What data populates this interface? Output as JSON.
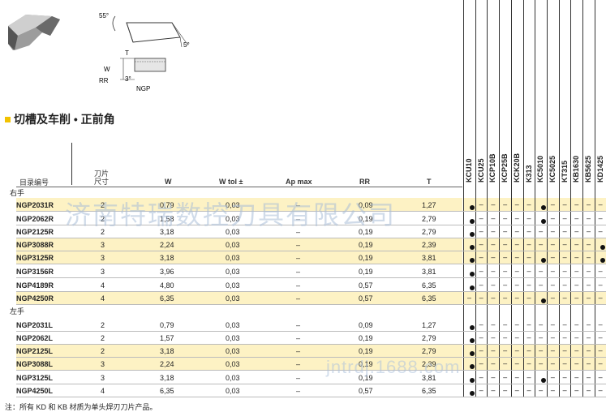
{
  "section_title": "切槽及车削 • 正前角",
  "drawing_labels": {
    "angle_top": "55°",
    "angle_side": "5°",
    "t": "T",
    "w": "W",
    "rr": "RR",
    "angle_small": "3°",
    "name": "NGP"
  },
  "headers": {
    "code": "目录编号",
    "blade_line1": "刀片",
    "blade_line2": "尺寸",
    "w": "W",
    "wtol": "W tol ±",
    "ap": "Ap max",
    "rr": "RR",
    "t": "T"
  },
  "grades": [
    "KCU10",
    "KCU25",
    "KCP10B",
    "KCP25B",
    "KCK20B",
    "K313",
    "KC5010",
    "KC5025",
    "KT315",
    "KB1630",
    "KB5625",
    "KD1425"
  ],
  "group_right": "右手",
  "group_left": "左手",
  "rows_right": [
    {
      "code": "NGP2031R",
      "blade": "2",
      "w": "0,79",
      "wtol": "0,03",
      "ap": "–",
      "rr": "0,09",
      "t": "1,27",
      "band": true,
      "marks": [
        "●",
        "–",
        "–",
        "–",
        "–",
        "–",
        "●",
        "–",
        "–",
        "–",
        "–",
        "–"
      ]
    },
    {
      "code": "NGP2062R",
      "blade": "2",
      "w": "1,58",
      "wtol": "0,03",
      "ap": "–",
      "rr": "0,19",
      "t": "2,79",
      "band": false,
      "marks": [
        "●",
        "–",
        "–",
        "–",
        "–",
        "–",
        "●",
        "–",
        "–",
        "–",
        "–",
        "–"
      ]
    },
    {
      "code": "NGP2125R",
      "blade": "2",
      "w": "3,18",
      "wtol": "0,03",
      "ap": "–",
      "rr": "0,19",
      "t": "2,79",
      "band": false,
      "marks": [
        "●",
        "–",
        "–",
        "–",
        "–",
        "–",
        "–",
        "–",
        "–",
        "–",
        "–",
        "–"
      ]
    },
    {
      "code": "NGP3088R",
      "blade": "3",
      "w": "2,24",
      "wtol": "0,03",
      "ap": "–",
      "rr": "0,19",
      "t": "2,39",
      "band": true,
      "marks": [
        "●",
        "–",
        "–",
        "–",
        "–",
        "–",
        "–",
        "–",
        "–",
        "–",
        "–",
        "●"
      ]
    },
    {
      "code": "NGP3125R",
      "blade": "3",
      "w": "3,18",
      "wtol": "0,03",
      "ap": "–",
      "rr": "0,19",
      "t": "3,81",
      "band": true,
      "marks": [
        "●",
        "–",
        "–",
        "–",
        "–",
        "–",
        "●",
        "–",
        "–",
        "–",
        "–",
        "●"
      ]
    },
    {
      "code": "NGP3156R",
      "blade": "3",
      "w": "3,96",
      "wtol": "0,03",
      "ap": "–",
      "rr": "0,19",
      "t": "3,81",
      "band": false,
      "marks": [
        "●",
        "–",
        "–",
        "–",
        "–",
        "–",
        "–",
        "–",
        "–",
        "–",
        "–",
        "–"
      ]
    },
    {
      "code": "NGP4189R",
      "blade": "4",
      "w": "4,80",
      "wtol": "0,03",
      "ap": "–",
      "rr": "0,57",
      "t": "6,35",
      "band": false,
      "marks": [
        "●",
        "–",
        "–",
        "–",
        "–",
        "–",
        "–",
        "–",
        "–",
        "–",
        "–",
        "–"
      ]
    },
    {
      "code": "NGP4250R",
      "blade": "4",
      "w": "6,35",
      "wtol": "0,03",
      "ap": "–",
      "rr": "0,57",
      "t": "6,35",
      "band": true,
      "marks": [
        "–",
        "–",
        "–",
        "–",
        "–",
        "–",
        "●",
        "–",
        "–",
        "–",
        "–",
        "–"
      ]
    }
  ],
  "rows_left": [
    {
      "code": "NGP2031L",
      "blade": "2",
      "w": "0,79",
      "wtol": "0,03",
      "ap": "–",
      "rr": "0,09",
      "t": "1,27",
      "band": false,
      "marks": [
        "●",
        "–",
        "–",
        "–",
        "–",
        "–",
        "–",
        "–",
        "–",
        "–",
        "–",
        "–"
      ]
    },
    {
      "code": "NGP2062L",
      "blade": "2",
      "w": "1,57",
      "wtol": "0,03",
      "ap": "–",
      "rr": "0,19",
      "t": "2,79",
      "band": false,
      "marks": [
        "●",
        "–",
        "–",
        "–",
        "–",
        "–",
        "–",
        "–",
        "–",
        "–",
        "–",
        "–"
      ]
    },
    {
      "code": "NGP2125L",
      "blade": "2",
      "w": "3,18",
      "wtol": "0,03",
      "ap": "–",
      "rr": "0,19",
      "t": "2,79",
      "band": true,
      "marks": [
        "●",
        "–",
        "–",
        "–",
        "–",
        "–",
        "–",
        "–",
        "–",
        "–",
        "–",
        "–"
      ]
    },
    {
      "code": "NGP3088L",
      "blade": "3",
      "w": "2,24",
      "wtol": "0,03",
      "ap": "–",
      "rr": "0,19",
      "t": "2,39",
      "band": true,
      "marks": [
        "●",
        "–",
        "–",
        "–",
        "–",
        "–",
        "–",
        "–",
        "–",
        "–",
        "–",
        "–"
      ]
    },
    {
      "code": "NGP3125L",
      "blade": "3",
      "w": "3,18",
      "wtol": "0,03",
      "ap": "–",
      "rr": "0,19",
      "t": "3,81",
      "band": false,
      "marks": [
        "●",
        "–",
        "–",
        "–",
        "–",
        "–",
        "●",
        "–",
        "–",
        "–",
        "–",
        "–"
      ]
    },
    {
      "code": "NGP4250L",
      "blade": "4",
      "w": "6,35",
      "wtol": "0,03",
      "ap": "–",
      "rr": "0,57",
      "t": "6,35",
      "band": false,
      "marks": [
        "●",
        "–",
        "–",
        "–",
        "–",
        "–",
        "–",
        "–",
        "–",
        "–",
        "–",
        "–"
      ]
    }
  ],
  "watermark": "济南特瑞数控刀具有限公司",
  "watermark_url": "jntrdj.1688.com",
  "note": "注：所有 KD 和 KB 材质为单头焊刃刀片产品。",
  "colors": {
    "accent": "#f2c200",
    "band": "#fdf2c4"
  }
}
